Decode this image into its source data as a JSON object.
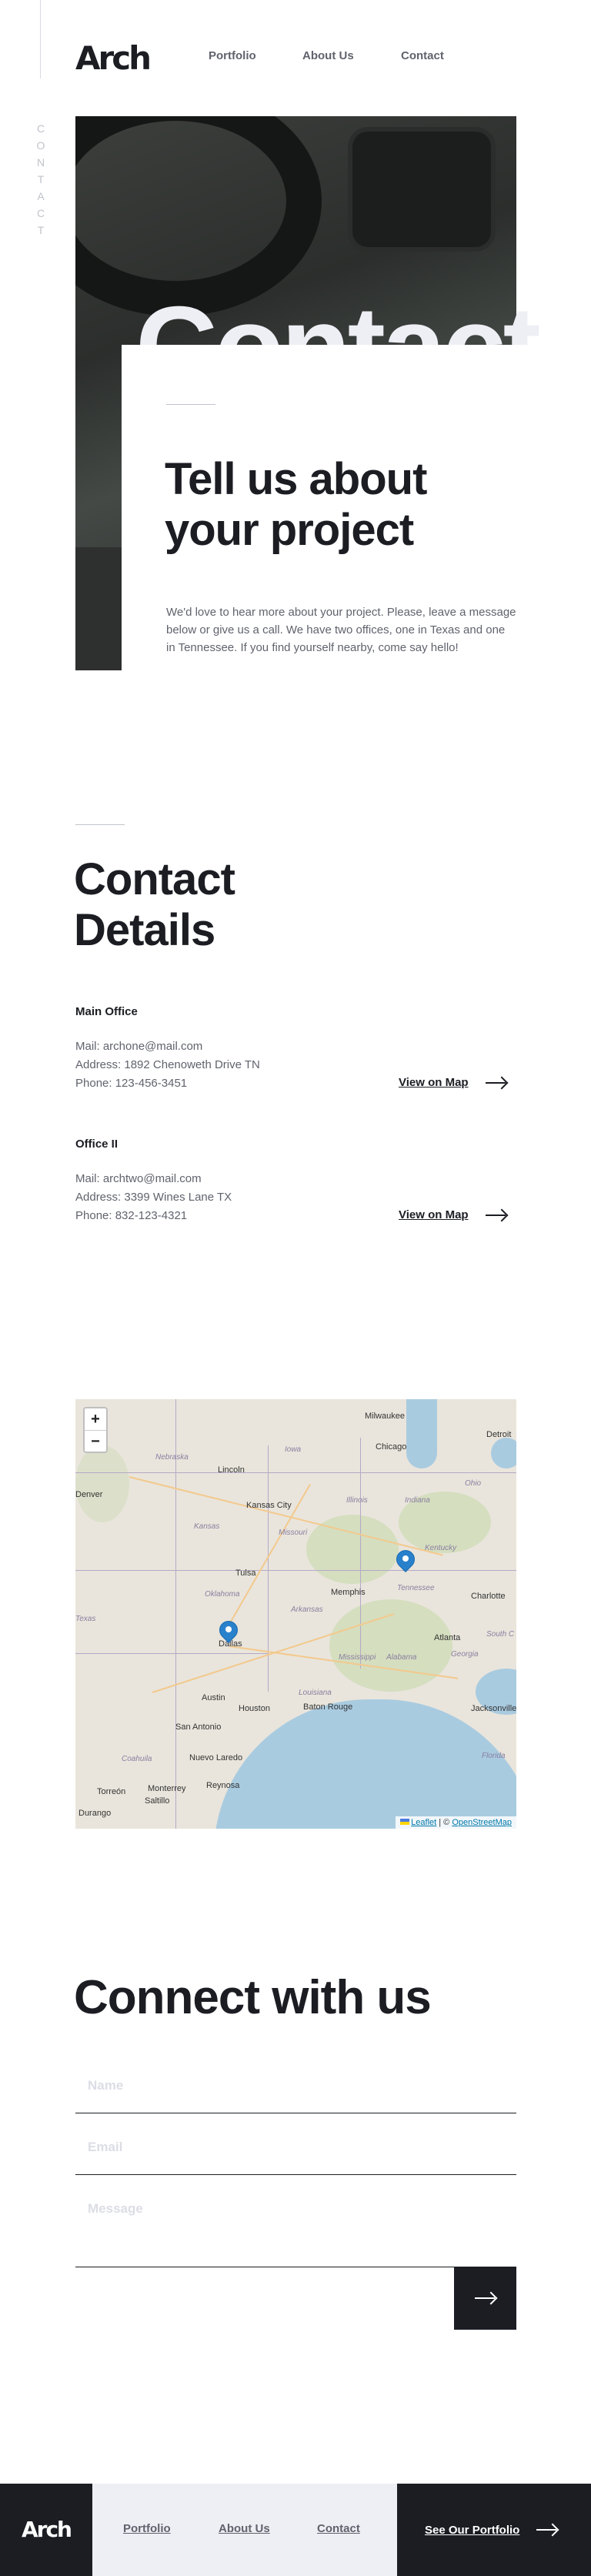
{
  "header": {
    "logo": "Arch",
    "nav": [
      "Portfolio",
      "About Us",
      "Contact"
    ],
    "side_label": [
      "C",
      "O",
      "N",
      "T",
      "A",
      "C",
      "T"
    ]
  },
  "hero": {
    "big_word": "Contact",
    "title": "Tell us about your project",
    "text": "We'd love to hear more about your project. Please, leave a message below or give us a call. We have two offices, one in Texas and one in Tennessee. If you find yourself nearby, come say hello!"
  },
  "details": {
    "title": "Contact Details",
    "offices": [
      {
        "name": "Main Office",
        "mail": "Mail: archone@mail.com",
        "address": "Address: 1892 Chenoweth Drive TN",
        "phone": "Phone: 123-456-3451",
        "link": "View on Map"
      },
      {
        "name": "Office II",
        "mail": "Mail: archtwo@mail.com",
        "address": "Address: 3399 Wines Lane TX",
        "phone": "Phone: 832-123-4321",
        "link": "View on Map"
      }
    ]
  },
  "map": {
    "zoom_in": "+",
    "zoom_out": "−",
    "attribution_leaflet": "Leaflet",
    "attribution_sep": " | © ",
    "attribution_osm": "OpenStreetMap",
    "cities": [
      "Milwaukee",
      "Detroit",
      "Chicago",
      "Lincoln",
      "Kansas City",
      "Tulsa",
      "Memphis",
      "Charlotte",
      "Atlanta",
      "Dallas",
      "Austin",
      "Houston",
      "Baton Rouge",
      "Jacksonville",
      "San Antonio",
      "Nuevo Laredo",
      "Torreón",
      "Monterrey",
      "Reynosa",
      "Saltillo",
      "Durango",
      "Denver"
    ],
    "states": [
      "Iowa",
      "Nebraska",
      "Illinois",
      "Indiana",
      "Ohio",
      "Kansas",
      "Missouri",
      "Kentucky",
      "Oklahoma",
      "Arkansas",
      "Tennessee",
      "Mississippi",
      "Alabama",
      "Georgia",
      "Louisiana",
      "Florida",
      "South C",
      "Coahuila",
      "Texas"
    ]
  },
  "connect": {
    "title": "Connect with us",
    "name_placeholder": "Name",
    "email_placeholder": "Email",
    "message_placeholder": "Message"
  },
  "footer": {
    "logo": "Arch",
    "nav": [
      "Portfolio",
      "About Us",
      "Contact"
    ],
    "cta": "See Our Portfolio"
  }
}
